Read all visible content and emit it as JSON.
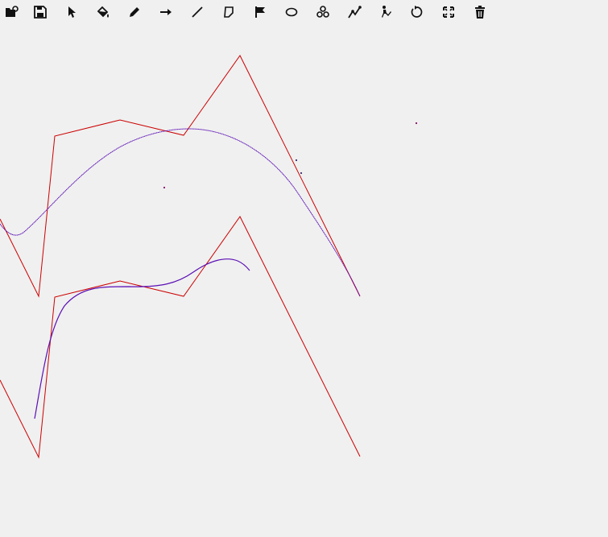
{
  "toolbar": {
    "tools": [
      {
        "name": "open-icon"
      },
      {
        "name": "save-icon"
      },
      {
        "name": "select-pointer-icon"
      },
      {
        "name": "fill-bucket-icon"
      },
      {
        "name": "pencil-icon"
      },
      {
        "name": "arrow-icon"
      },
      {
        "name": "line-icon"
      },
      {
        "name": "polygon-icon"
      },
      {
        "name": "flag-icon"
      },
      {
        "name": "ellipse-icon"
      },
      {
        "name": "spiral-icon"
      },
      {
        "name": "polyline-bezier-icon"
      },
      {
        "name": "figure-icon"
      },
      {
        "name": "rotate-icon"
      },
      {
        "name": "fullscreen-icon"
      },
      {
        "name": "trash-icon"
      }
    ]
  },
  "canvas": {
    "colors": {
      "polyline": "#cc0000",
      "curve": "#5b0fb5",
      "point": "#8a0d6a"
    }
  }
}
